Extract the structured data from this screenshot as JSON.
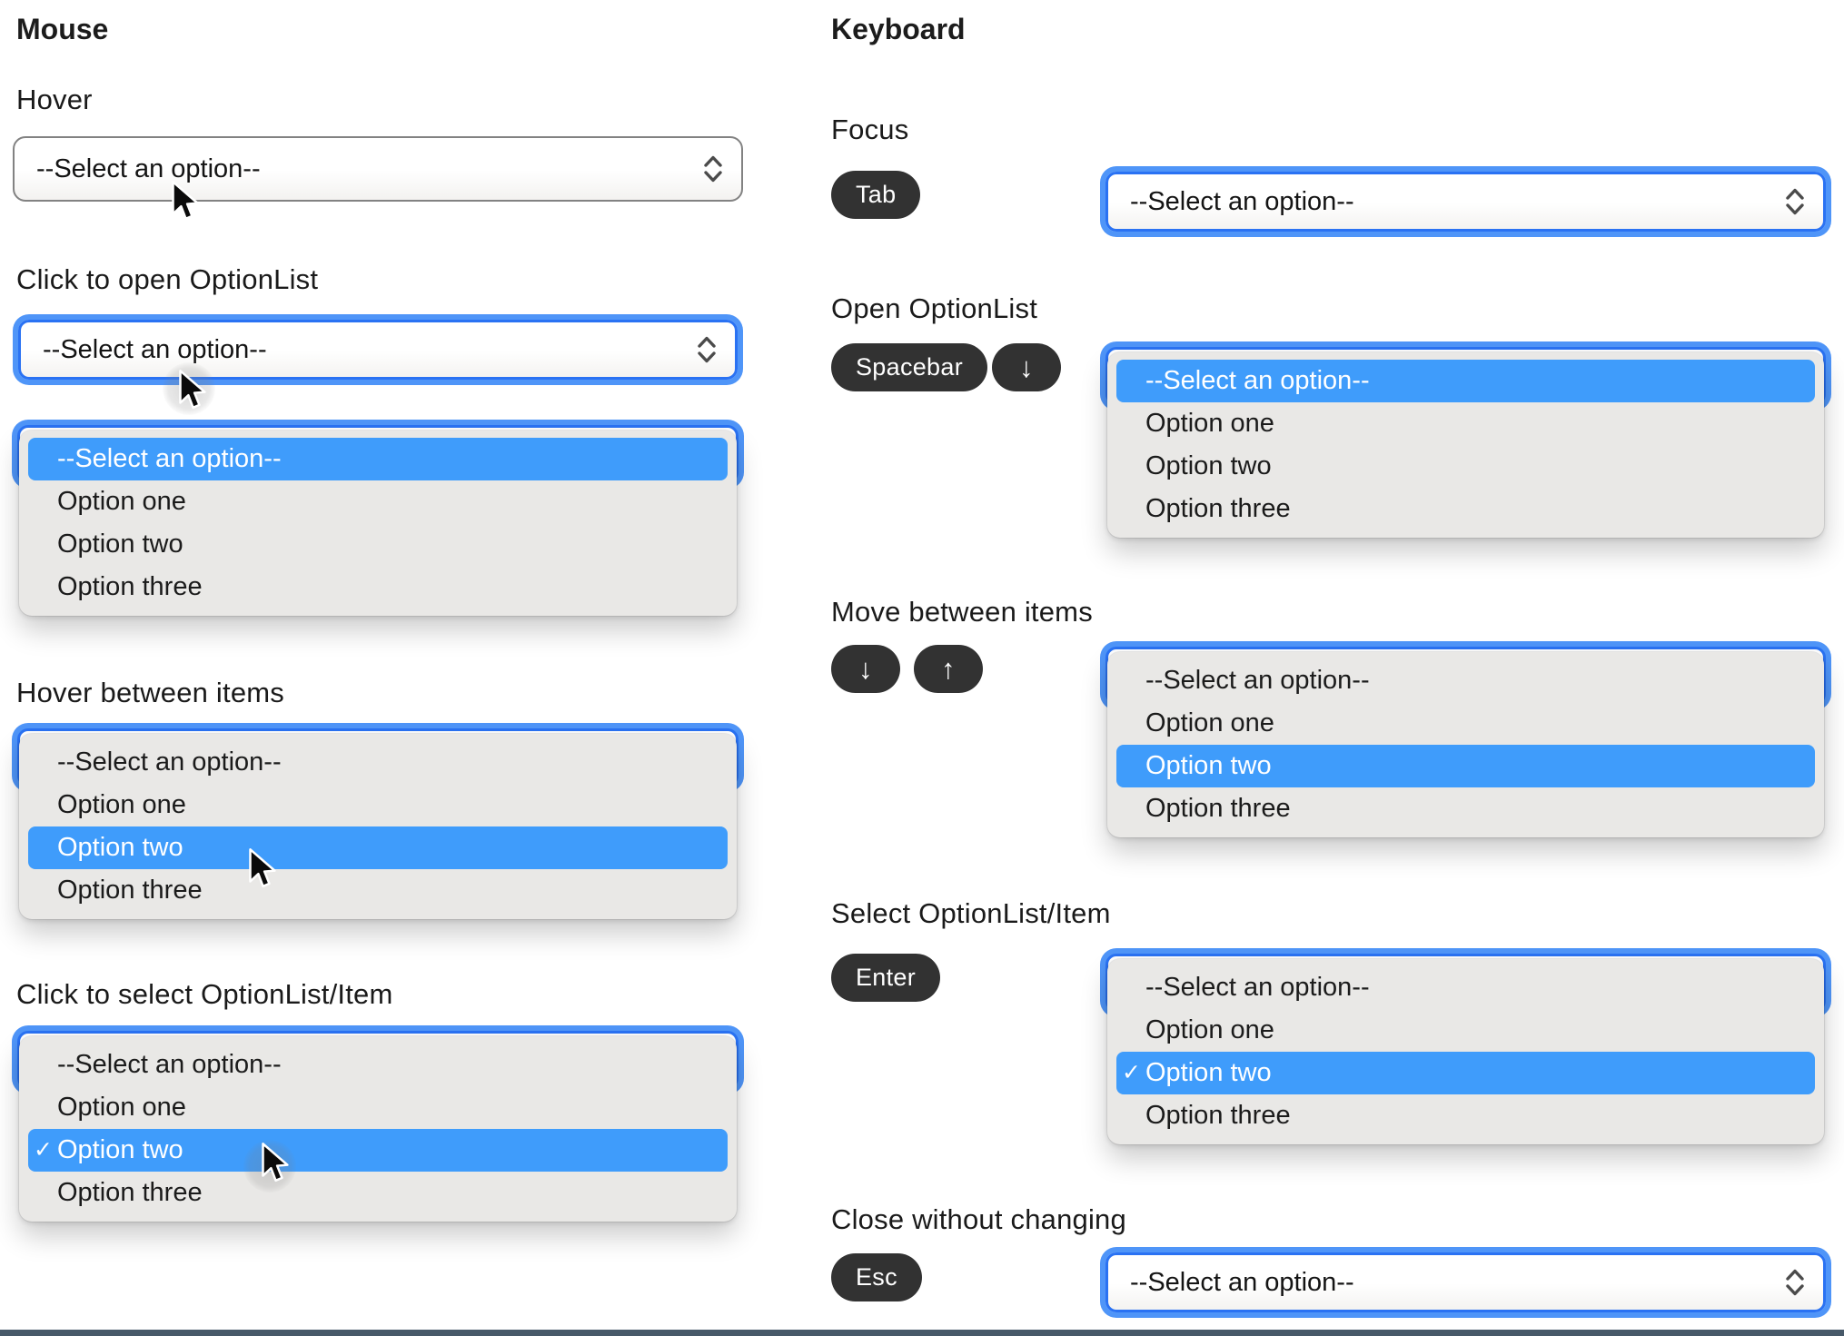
{
  "colors": {
    "highlight_blue": "#3f9cfb",
    "focus_ring_outer": "#4f95f8",
    "focus_ring_inner": "#2a72f3",
    "panel_background": "#e9e8e6",
    "key_badge_background": "#323232",
    "select_border": "#828282",
    "bottom_bar": "#475969"
  },
  "select": {
    "placeholder": "--Select an option--",
    "options": [
      "--Select an option--",
      "Option one",
      "Option two",
      "Option three"
    ],
    "checkmark": "✓"
  },
  "mouse": {
    "title": "Mouse",
    "hover_label": "Hover",
    "click_open_label": "Click to open OptionList",
    "hover_items_label": "Hover between items",
    "click_select_label": "Click to select OptionList/Item"
  },
  "keyboard": {
    "title": "Keyboard",
    "focus_label": "Focus",
    "open_label": "Open OptionList",
    "move_label": "Move between items",
    "select_label": "Select OptionList/Item",
    "close_label": "Close without changing",
    "keys": {
      "tab": "Tab",
      "spacebar": "Spacebar",
      "down": "↓",
      "up": "↑",
      "enter": "Enter",
      "esc": "Esc"
    }
  }
}
